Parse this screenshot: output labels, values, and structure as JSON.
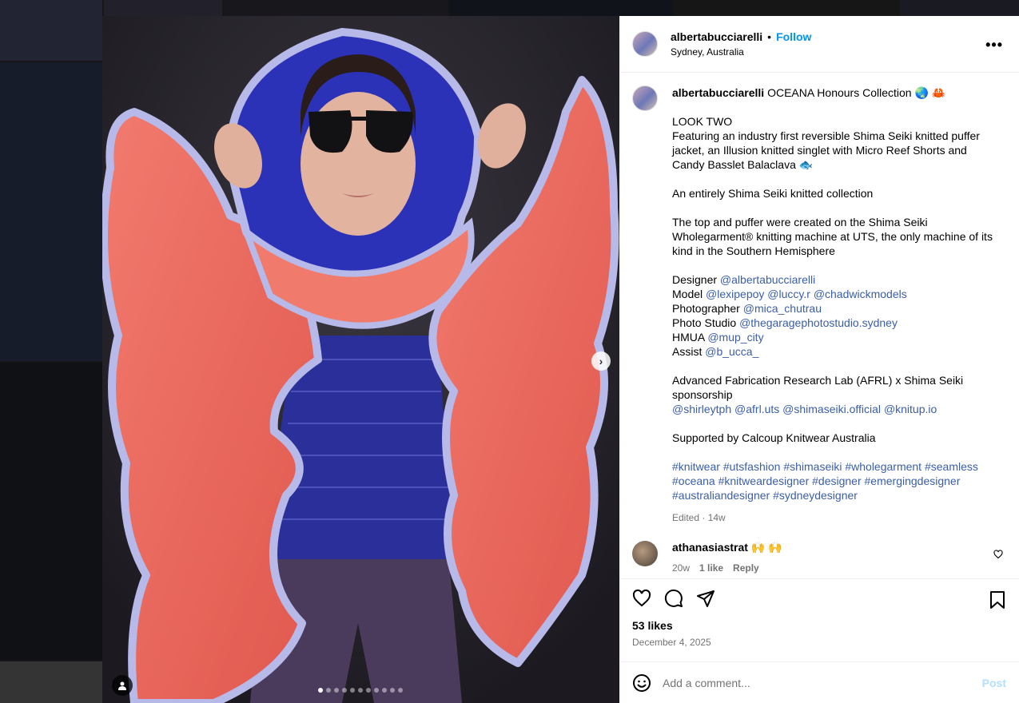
{
  "post": {
    "username": "albertabucciarelli",
    "separator": "•",
    "follow_label": "Follow",
    "location": "Sydney, Australia",
    "more_label": "•••"
  },
  "caption": {
    "username": "albertabucciarelli",
    "title": "OCEANA Honours Collection 🌏 🦀",
    "line_look": "LOOK TWO",
    "line_desc": "Featuring an industry first reversible Shima Seiki knitted puffer jacket, an Illusion knitted singlet with Micro Reef Shorts and Candy Basslet Balaclava 🐟",
    "line_entirely": "An entirely Shima Seiki knitted collection",
    "line_top": "The top and puffer were created on the Shima Seiki Wholegarment® knitting machine at UTS, the only machine of its kind in the Southern Hemisphere",
    "credits": [
      {
        "role": "Designer",
        "tags": [
          "@albertabucciarelli"
        ]
      },
      {
        "role": "Model",
        "tags": [
          "@lexipepoy",
          "@luccy.r",
          "@chadwickmodels"
        ]
      },
      {
        "role": "Photographer",
        "tags": [
          "@mica_chutrau"
        ]
      },
      {
        "role": "Photo Studio",
        "tags": [
          "@thegaragephotostudio.sydney"
        ]
      },
      {
        "role": "HMUA",
        "tags": [
          "@mup_city"
        ]
      },
      {
        "role": "Assist",
        "tags": [
          "@b_ucca_"
        ]
      }
    ],
    "line_afrl": "Advanced Fabrication Research Lab (AFRL) x Shima Seiki sponsorship",
    "afrl_tags": [
      "@shirleytph",
      "@afrl.uts",
      "@shimaseiki.official",
      "@knitup.io"
    ],
    "line_supported": "Supported by Calcoup Knitwear Australia",
    "hashtags": [
      "#knitwear",
      "#utsfashion",
      "#shimaseiki",
      "#wholegarment",
      "#seamless",
      "#oceana",
      "#knitweardesigner",
      "#designer",
      "#emergingdesigner",
      "#australiandesigner",
      "#sydneydesigner"
    ],
    "edited": "Edited · 14w"
  },
  "comment": {
    "username": "athanasiastrat",
    "text": "🙌 🙌",
    "age": "20w",
    "likes": "1 like",
    "reply_label": "Reply"
  },
  "actions": {
    "likes": "53 likes",
    "date": "December 4, 2025"
  },
  "add_comment": {
    "placeholder": "Add a comment...",
    "post_label": "Post"
  },
  "carousel": {
    "total_slides": 11,
    "active_slide": 1
  },
  "icons": {
    "heart": "heart-icon",
    "comment": "comment-icon",
    "share": "share-icon",
    "bookmark": "bookmark-icon",
    "emoji": "emoji-icon",
    "next": "chevron-right-icon",
    "user_tag": "user-icon"
  },
  "colors": {
    "link": "#3b5ea9",
    "follow": "#0095f6",
    "post_disabled": "#b2dffc",
    "muted": "#737373"
  }
}
